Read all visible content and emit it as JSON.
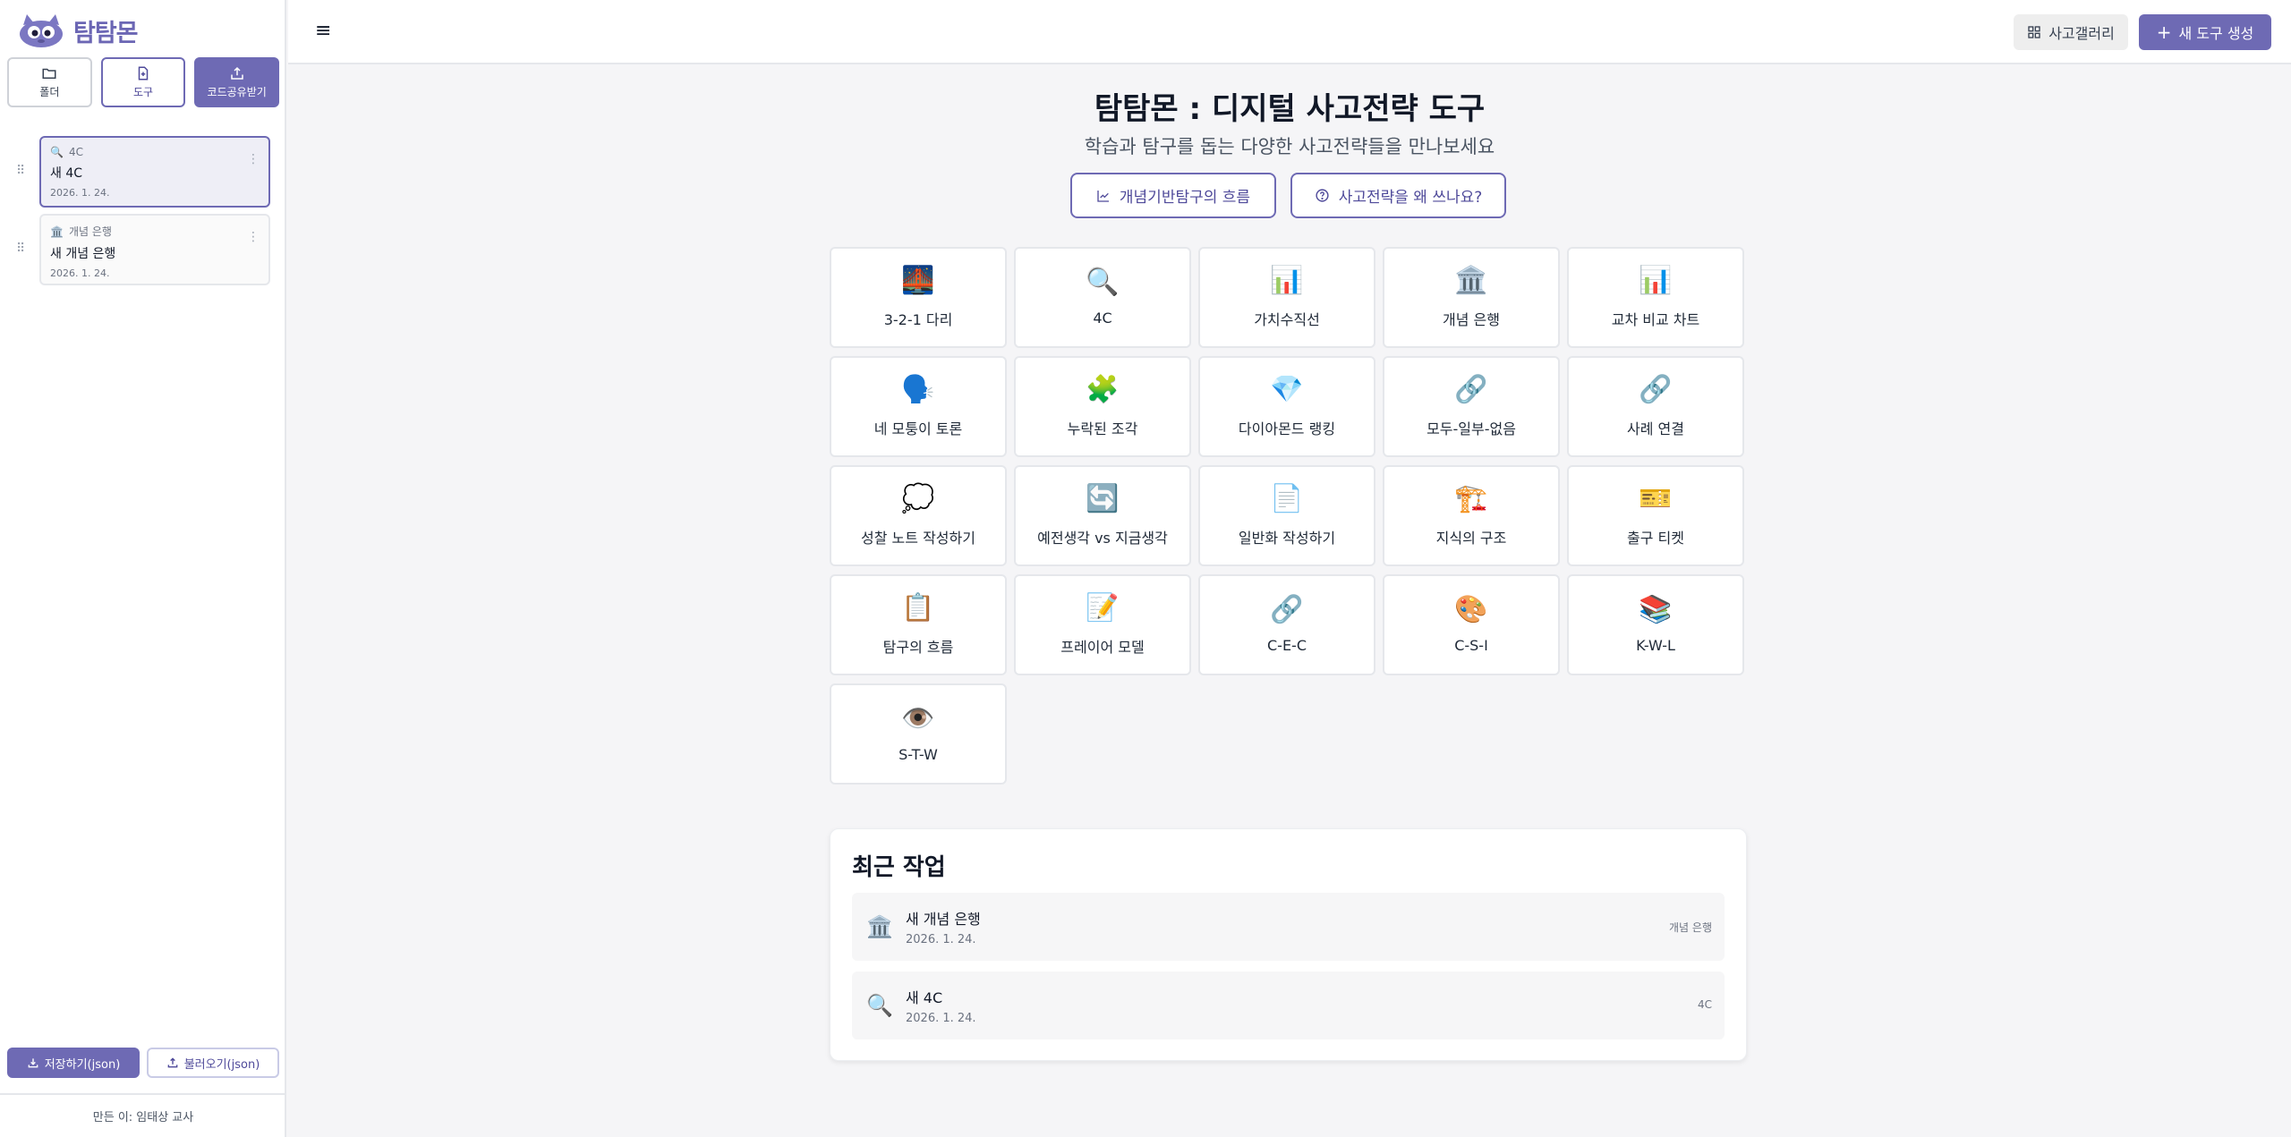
{
  "app": {
    "name": "탐탐몬"
  },
  "sidebar": {
    "buttons": [
      {
        "label": "폴더",
        "icon": "folder-icon"
      },
      {
        "label": "도구",
        "icon": "file-plus-icon"
      },
      {
        "label": "코드공유받기",
        "icon": "upload-icon"
      }
    ],
    "files": [
      {
        "type": "4C",
        "type_icon": "🔍",
        "name": "새 4C",
        "date": "2026. 1. 24."
      },
      {
        "type": "개념 은행",
        "type_icon": "🏛️",
        "name": "새 개념 은행",
        "date": "2026. 1. 24."
      }
    ],
    "save_label": "저장하기(json)",
    "load_label": "불러오기(json)",
    "footer": "만든 이: 임태상 교사"
  },
  "header": {
    "gallery_label": "사고갤러리",
    "new_label": "새 도구 생성"
  },
  "main": {
    "title": "탐탐몬 : 디지털 사고전략 도구",
    "subtitle": "학습과 탐구를 돕는 다양한 사고전략들을 만나보세요",
    "hero_buttons": [
      {
        "label": "개념기반탐구의 흐름",
        "icon": "chart-line-icon"
      },
      {
        "label": "사고전략을 왜 쓰나요?",
        "icon": "help-circle-icon"
      }
    ],
    "tools": [
      {
        "label": "3-2-1 다리",
        "emoji": "🌉"
      },
      {
        "label": "4C",
        "emoji": "🔍"
      },
      {
        "label": "가치수직선",
        "emoji": "📊"
      },
      {
        "label": "개념 은행",
        "emoji": "🏛️"
      },
      {
        "label": "교차 비교 차트",
        "emoji": "📊"
      },
      {
        "label": "네 모퉁이 토론",
        "emoji": "🗣️"
      },
      {
        "label": "누락된 조각",
        "emoji": "🧩"
      },
      {
        "label": "다이아몬드 랭킹",
        "emoji": "💎"
      },
      {
        "label": "모두-일부-없음",
        "emoji": "🔗"
      },
      {
        "label": "사례 연결",
        "emoji": "🔗"
      },
      {
        "label": "성찰 노트 작성하기",
        "emoji": "💭"
      },
      {
        "label": "예전생각 vs 지금생각",
        "emoji": "🔄"
      },
      {
        "label": "일반화 작성하기",
        "emoji": "📄"
      },
      {
        "label": "지식의 구조",
        "emoji": "🏗️"
      },
      {
        "label": "출구 티켓",
        "emoji": "🎫"
      },
      {
        "label": "탐구의 흐름",
        "emoji": "📋"
      },
      {
        "label": "프레이어 모델",
        "emoji": "📝"
      },
      {
        "label": "C-E-C",
        "emoji": "🔗"
      },
      {
        "label": "C-S-I",
        "emoji": "🎨"
      },
      {
        "label": "K-W-L",
        "emoji": "📚"
      },
      {
        "label": "S-T-W",
        "emoji": "👁️"
      }
    ],
    "recent": {
      "title": "최근 작업",
      "items": [
        {
          "icon": "🏛️",
          "name": "새 개념 은행",
          "date": "2026. 1. 24.",
          "type": "개념 은행"
        },
        {
          "icon": "🔍",
          "name": "새 4C",
          "date": "2026. 1. 24.",
          "type": "4C"
        }
      ]
    }
  },
  "colors": {
    "accent": "#6e6ab4",
    "background": "#f5f5f7"
  }
}
